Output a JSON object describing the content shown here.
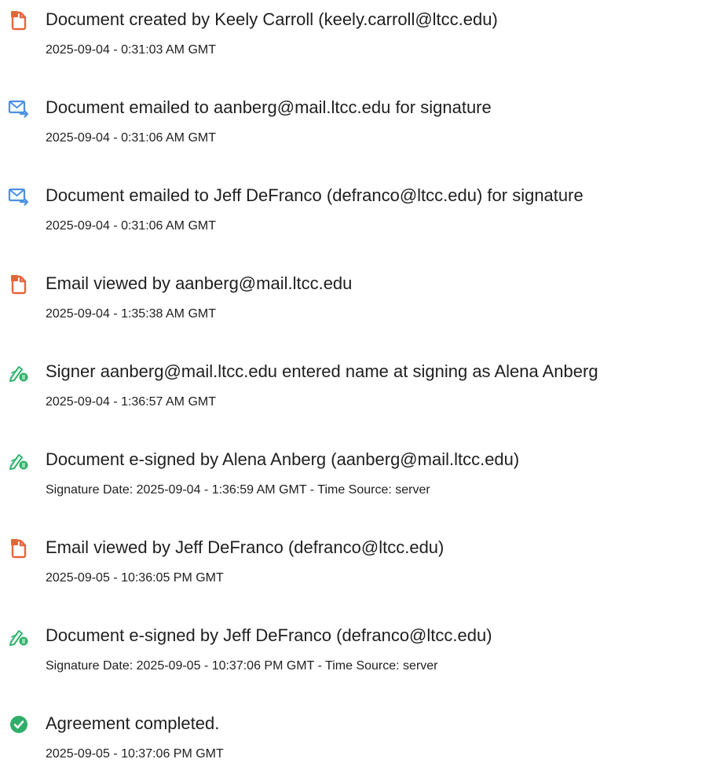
{
  "entries": [
    {
      "icon": "document-icon",
      "title": "Document created by Keely Carroll (keely.carroll@ltcc.edu)",
      "time": "2025-09-04 - 0:31:03 AM GMT"
    },
    {
      "icon": "email-sent-icon",
      "title": "Document emailed to aanberg@mail.ltcc.edu for signature",
      "time": "2025-09-04 - 0:31:06 AM GMT"
    },
    {
      "icon": "email-sent-icon",
      "title": "Document emailed to Jeff DeFranco (defranco@ltcc.edu) for signature",
      "time": "2025-09-04 - 0:31:06 AM GMT"
    },
    {
      "icon": "document-icon",
      "title": "Email viewed by aanberg@mail.ltcc.edu",
      "time": "2025-09-04 - 1:35:38 AM GMT"
    },
    {
      "icon": "esign-pen-icon",
      "title": "Signer aanberg@mail.ltcc.edu entered name at signing as Alena Anberg",
      "time": "2025-09-04 - 1:36:57 AM GMT"
    },
    {
      "icon": "esign-pen-icon",
      "title": "Document e-signed by Alena Anberg (aanberg@mail.ltcc.edu)",
      "time": "Signature Date: 2025-09-04 - 1:36:59 AM GMT - Time Source: server"
    },
    {
      "icon": "document-icon",
      "title": "Email viewed by Jeff DeFranco (defranco@ltcc.edu)",
      "time": "2025-09-05 - 10:36:05 PM GMT"
    },
    {
      "icon": "esign-pen-icon",
      "title": "Document e-signed by Jeff DeFranco (defranco@ltcc.edu)",
      "time": "Signature Date: 2025-09-05 - 10:37:06 PM GMT - Time Source: server"
    },
    {
      "icon": "check-circle-icon",
      "title": "Agreement completed.",
      "time": "2025-09-05 - 10:37:06 PM GMT"
    }
  ],
  "colors": {
    "document_icon": "#e8633a",
    "email_icon": "#4b90e2",
    "esign_icon": "#2fb36a",
    "check_icon": "#2fae6a",
    "text": "#1f1f1f"
  }
}
